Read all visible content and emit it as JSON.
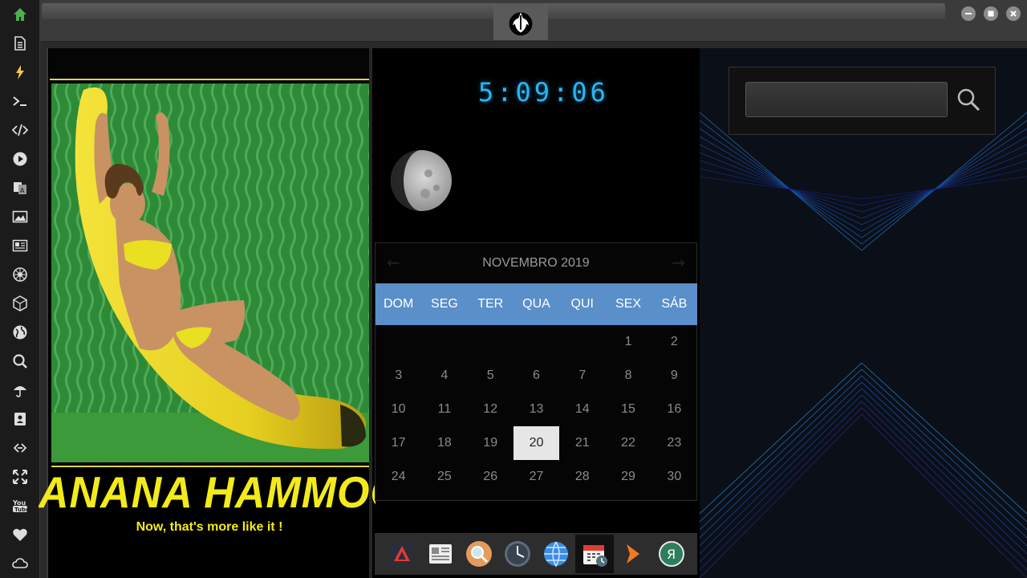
{
  "sidebar": {
    "items": [
      {
        "name": "home-icon",
        "color": "#4caf50"
      },
      {
        "name": "document-icon"
      },
      {
        "name": "lightning-icon",
        "color": "#f2c94c"
      },
      {
        "name": "terminal-icon"
      },
      {
        "name": "code-icon"
      },
      {
        "name": "play-icon"
      },
      {
        "name": "translate-icon"
      },
      {
        "name": "image-icon"
      },
      {
        "name": "news-icon"
      },
      {
        "name": "rebel-icon"
      },
      {
        "name": "cube-icon"
      },
      {
        "name": "globe-icon"
      },
      {
        "name": "search-icon"
      },
      {
        "name": "umbrella-icon"
      },
      {
        "name": "contacts-icon"
      },
      {
        "name": "link-icon"
      },
      {
        "name": "expand-icon"
      },
      {
        "name": "youtube-icon"
      },
      {
        "name": "heart-icon"
      },
      {
        "name": "cloud-icon"
      }
    ]
  },
  "topbar": {
    "tab_icon": "rebel-alliance-icon",
    "window_controls": [
      "minimize",
      "maximize",
      "close"
    ]
  },
  "poster": {
    "title": "ANANA HAMMOC",
    "subtitle": "Now, that's more like it !"
  },
  "clock": {
    "time": "5:09:06",
    "color": "#29b6f6"
  },
  "moon": {
    "phase": "waxing-crescent"
  },
  "calendar": {
    "month_label": "NOVEMBRO 2019",
    "prev_arrow": "←",
    "next_arrow": "→",
    "weekdays": [
      "DOM",
      "SEG",
      "TER",
      "QUA",
      "QUI",
      "SEX",
      "SÁB"
    ],
    "weeks": [
      [
        "",
        "",
        "",
        "",
        "",
        "1",
        "2"
      ],
      [
        "3",
        "4",
        "5",
        "6",
        "7",
        "8",
        "9"
      ],
      [
        "10",
        "11",
        "12",
        "13",
        "14",
        "15",
        "16"
      ],
      [
        "17",
        "18",
        "19",
        "20",
        "21",
        "22",
        "23"
      ],
      [
        "24",
        "25",
        "26",
        "27",
        "28",
        "29",
        "30"
      ]
    ],
    "today": "20",
    "header_color": "#5a8fc9"
  },
  "dock": {
    "items": [
      {
        "name": "app-launcher-icon"
      },
      {
        "name": "news-reader-icon"
      },
      {
        "name": "search-app-icon"
      },
      {
        "name": "clock-app-icon"
      },
      {
        "name": "browser-icon"
      },
      {
        "name": "calendar-app-icon",
        "active": true
      },
      {
        "name": "arrow-app-icon"
      },
      {
        "name": "yandex-icon",
        "label": "Я"
      }
    ]
  },
  "search": {
    "value": "",
    "placeholder": ""
  }
}
